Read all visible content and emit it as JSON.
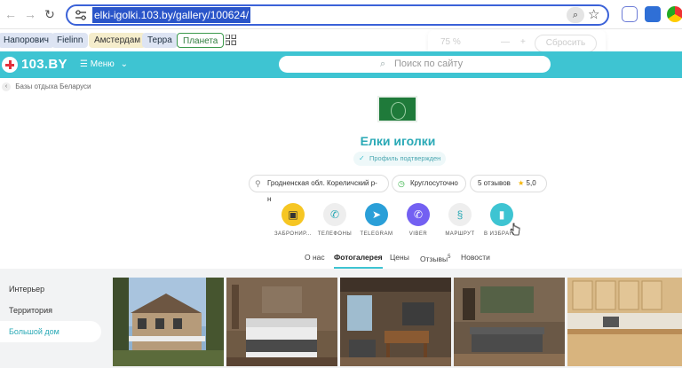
{
  "browser": {
    "url": "elki-igolki.103.by/gallery/100624/",
    "bookmarks": [
      "Напорович",
      "Fielinn",
      "Амстердам",
      "Терра",
      "Планета"
    ],
    "zoom_popup": {
      "percent": "75 %",
      "minus": "—",
      "plus": "+",
      "reset": "Сбросить"
    }
  },
  "site": {
    "logo": "103.BY",
    "menu_label": "Меню",
    "search_placeholder": "Поиск по сайту"
  },
  "breadcrumb": "Базы отдыха Беларуси",
  "company": {
    "name": "Елки иголки",
    "verified": "Профиль подтвержден",
    "region": "Гродненская обл. Кореличский р-н",
    "hours": "Круглосуточно",
    "reviews": "5 отзывов",
    "rating": "5,0"
  },
  "actions": [
    {
      "label": "ЗАБРОНИР...",
      "icon": "calendar-icon",
      "color": "#f6c623"
    },
    {
      "label": "ТЕЛЕФОНЫ",
      "icon": "phone-icon",
      "color": "#f0f0f0"
    },
    {
      "label": "TELEGRAM",
      "icon": "telegram-icon",
      "color": "#2a9fd8"
    },
    {
      "label": "VIBER",
      "icon": "viber-icon",
      "color": "#7360f2"
    },
    {
      "label": "МАРШРУТ",
      "icon": "route-icon",
      "color": "#f0f0f0"
    },
    {
      "label": "В ИЗБРАН...",
      "icon": "bookmark-icon",
      "color": "#3ec4d2"
    }
  ],
  "tabs": [
    "О нас",
    "Фотогалерея",
    "Цены",
    "Отзывы",
    "Новости"
  ],
  "tab_reviews_count": "5",
  "gallery_categories": [
    "Интерьер",
    "Территория",
    "Большой дом"
  ],
  "colors": {
    "accent": "#3ec4d2",
    "title": "#2aa9b6"
  }
}
